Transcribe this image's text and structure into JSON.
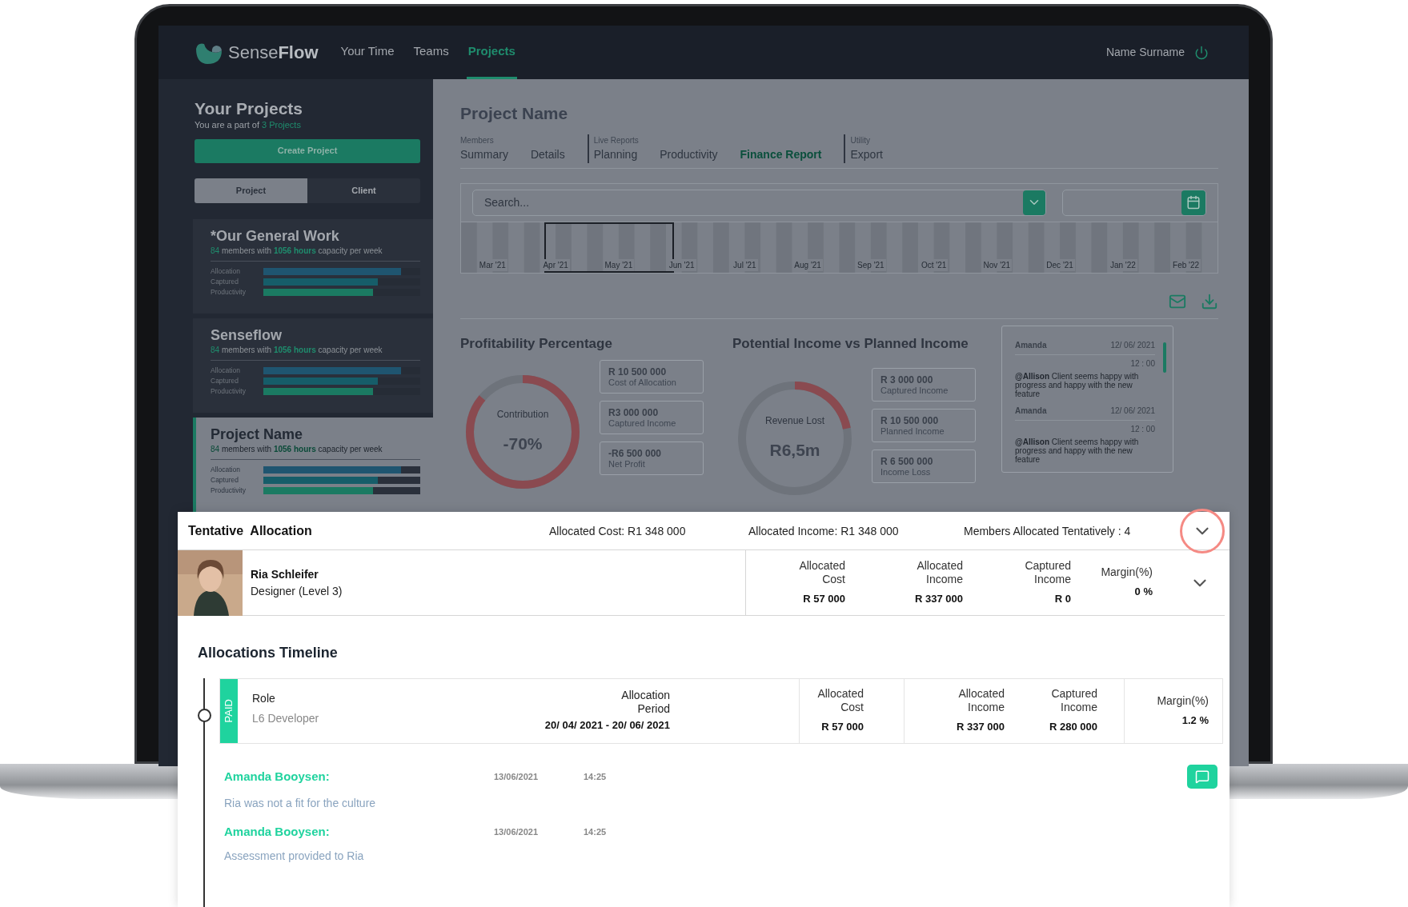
{
  "nav": {
    "brand_light": "Sense",
    "brand_bold": "Flow",
    "items": [
      {
        "label": "Your Time",
        "selected": false
      },
      {
        "label": "Teams",
        "selected": false
      },
      {
        "label": "Projects",
        "selected": true
      }
    ],
    "user": "Name Surname"
  },
  "sidebar": {
    "title": "Your Projects",
    "subtitle": "You are a part of ",
    "subtitle_link": "3 Projects",
    "create_button": "Create Project",
    "toggle": [
      {
        "label": "Project",
        "selected": true
      },
      {
        "label": "Client",
        "selected": false
      }
    ],
    "projects": [
      {
        "name": "*Our General Work",
        "members": "84",
        "members_text": " members with ",
        "hours": "1056 hours",
        "hours_text": " capacity per week",
        "selected": false,
        "bars": [
          {
            "label": "Allocation",
            "level": 0.88
          },
          {
            "label": "Captured",
            "level": 0.73
          },
          {
            "label": "Productivity",
            "level": 0.7
          }
        ]
      },
      {
        "name": "Senseflow",
        "members": "84",
        "members_text": " members with ",
        "hours": "1056 hours",
        "hours_text": " capacity per week",
        "selected": false,
        "bars": [
          {
            "label": "Allocation",
            "level": 0.88
          },
          {
            "label": "Captured",
            "level": 0.73
          },
          {
            "label": "Productivity",
            "level": 0.7
          }
        ]
      },
      {
        "name": "Project Name",
        "members": "84",
        "members_text": " members with ",
        "hours": "1056 hours",
        "hours_text": " capacity per week",
        "selected": true,
        "bars": [
          {
            "label": "Allocation",
            "level": 0.88
          },
          {
            "label": "Captured",
            "level": 0.73
          },
          {
            "label": "Productivity",
            "level": 0.7
          }
        ]
      }
    ]
  },
  "main": {
    "title": "Project Name",
    "tab_groups": [
      {
        "heading": "Members",
        "tabs": [
          {
            "label": "Summary",
            "selected": false
          },
          {
            "label": "Details",
            "selected": false
          }
        ]
      },
      {
        "heading": "Live Reports",
        "tabs": [
          {
            "label": "Planning",
            "selected": false
          },
          {
            "label": "Productivity",
            "selected": false
          },
          {
            "label": "Finance Report",
            "selected": true
          }
        ]
      },
      {
        "heading": "Utility",
        "tabs": [
          {
            "label": "Export",
            "selected": false
          }
        ]
      }
    ],
    "search": {
      "placeholder": "Search..."
    },
    "months": [
      {
        "label": "Mar '21",
        "selected": false
      },
      {
        "label": "Apr '21",
        "selected": true
      },
      {
        "label": "May '21",
        "selected": true
      },
      {
        "label": "Jun '21",
        "selected": true
      },
      {
        "label": "Jul '21",
        "selected": false
      },
      {
        "label": "Aug '21",
        "selected": false
      },
      {
        "label": "Sep '21",
        "selected": false
      },
      {
        "label": "Oct '21",
        "selected": false
      },
      {
        "label": "Nov '21",
        "selected": false
      },
      {
        "label": "Dec '21",
        "selected": false
      },
      {
        "label": "Jan '22",
        "selected": false
      },
      {
        "label": "Feb '22",
        "selected": false
      }
    ],
    "profitability": {
      "title": "Profitability Percentage",
      "donut": {
        "label": "Contribution",
        "value": "-70%",
        "level": 0.86
      },
      "cards": [
        {
          "value": "R 10 500 000",
          "label": "Cost of Allocation"
        },
        {
          "value": "R3 000 000",
          "label": "Captured Income"
        },
        {
          "value": "-R6 500 000",
          "label": "Net Profit"
        }
      ]
    },
    "income": {
      "title": "Potential Income vs Planned Income",
      "donut": {
        "label": "Revenue Lost",
        "value": "R6,5m",
        "level": 0.22
      },
      "cards": [
        {
          "value": "R 3 000 000",
          "label": "Captured Income"
        },
        {
          "value": "R 10 500 000",
          "label": "Planned Income"
        },
        {
          "value": "R 6 500 000",
          "label": "Income Loss"
        }
      ]
    },
    "comments": [
      {
        "author": "Amanda",
        "date": "12/ 06/ 2021",
        "time": "12 : 00",
        "text": "**@Allison** Client seems happy with progress and happy with the new feature"
      },
      {
        "author": "Amanda",
        "date": "12/ 06/ 2021",
        "time": "12 : 00",
        "text": "**@Allison** Client seems happy with progress and happy with the new feature"
      }
    ]
  },
  "tentative": {
    "title": "Tentative  Allocation",
    "stats": [
      "Allocated Cost: R1 348 000",
      "Allocated Income: R1 348 000",
      "Members Allocated Tentatively : 4"
    ],
    "expanded": true,
    "member": {
      "name": "Ria Schleifer",
      "role": "Designer (Level 3)",
      "columns": [
        {
          "label": "Allocated Cost",
          "value": "R 57 000"
        },
        {
          "label": "Allocated Income",
          "value": "R 337 000"
        },
        {
          "label": "Captured Income",
          "value": "R 0"
        },
        {
          "label": "Margin(%)",
          "value": "0 %"
        }
      ]
    }
  },
  "timeline": {
    "title": "Allocations Timeline",
    "entry": {
      "status": "PAID",
      "role_label": "Role",
      "role": "L6 Developer",
      "period_label": "Allocation Period",
      "period": "20/ 04/ 2021 - 20/ 06/ 2021",
      "columns": [
        {
          "label": "Allocated Cost",
          "value": "R 57 000"
        },
        {
          "label": "Allocated Income",
          "value": "R 337 000"
        },
        {
          "label": "Captured Income",
          "value": "R 280 000"
        },
        {
          "label": "Margin(%)",
          "value": "1.2 %"
        }
      ]
    },
    "notes": [
      {
        "author": "Amanda Booysen:",
        "date": "13/06/2021",
        "time": "14:25",
        "text": "Ria was not a fit for the culture"
      },
      {
        "author": "Amanda Booysen:",
        "date": "13/06/2021",
        "time": "14:25",
        "text": "Assessment provided to Ria"
      }
    ]
  }
}
